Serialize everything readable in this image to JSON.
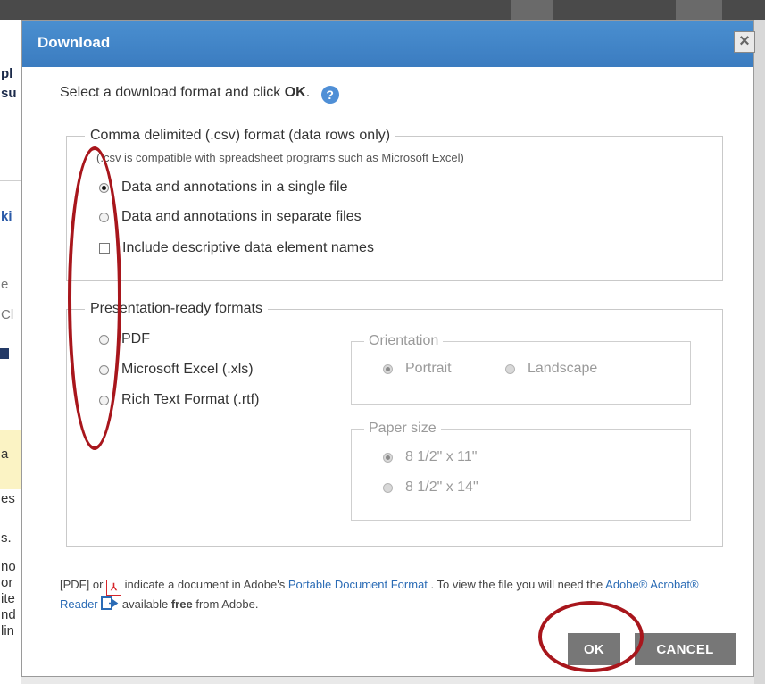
{
  "background": {
    "fragments": [
      "pl",
      "su",
      "ki",
      "e",
      "Cl",
      "a",
      "es",
      "s.",
      "no",
      "or",
      "ite",
      "nd",
      "lin"
    ]
  },
  "dialog": {
    "title": "Download",
    "close_glyph": "×",
    "intro_text": "Select a download format and click",
    "intro_bold": "OK",
    "intro_end": ".",
    "help_glyph": "?",
    "csv_group": {
      "legend": "Comma delimited (.csv) format (data rows only)",
      "note": "(.csv is compatible with spreadsheet programs such as Microsoft Excel)",
      "option_single": "Data and annotations in a single file",
      "option_separate": "Data and annotations in separate files",
      "checkbox_names": "Include descriptive data element names",
      "selected": "single"
    },
    "presentation_group": {
      "legend": "Presentation-ready formats",
      "option_pdf": "PDF",
      "option_excel": "Microsoft Excel (.xls)",
      "option_rtf": "Rich Text Format (.rtf)",
      "orientation": {
        "legend": "Orientation",
        "portrait": "Portrait",
        "landscape": "Landscape"
      },
      "paper_size": {
        "legend": "Paper size",
        "letter": "8 1/2\" x 11\"",
        "legal": "8 1/2\" x 14\""
      }
    },
    "footer": {
      "pdf_prefix": "[PDF] or",
      "pdf_icon_glyph": "⅄",
      "text1": "indicate a document in Adobe's",
      "pdf_link": "Portable Document Format",
      "text2": ". To view the file you will need the",
      "reader_link": "Adobe® Acrobat® Reader",
      "text3": "available",
      "free": "free",
      "text4": "from Adobe."
    },
    "ok_label": "OK",
    "cancel_label": "CANCEL"
  },
  "colors": {
    "titlebar": "#3b7cc0",
    "button": "#777777",
    "annotation": "#a8161c",
    "link": "#2a6bb5"
  }
}
